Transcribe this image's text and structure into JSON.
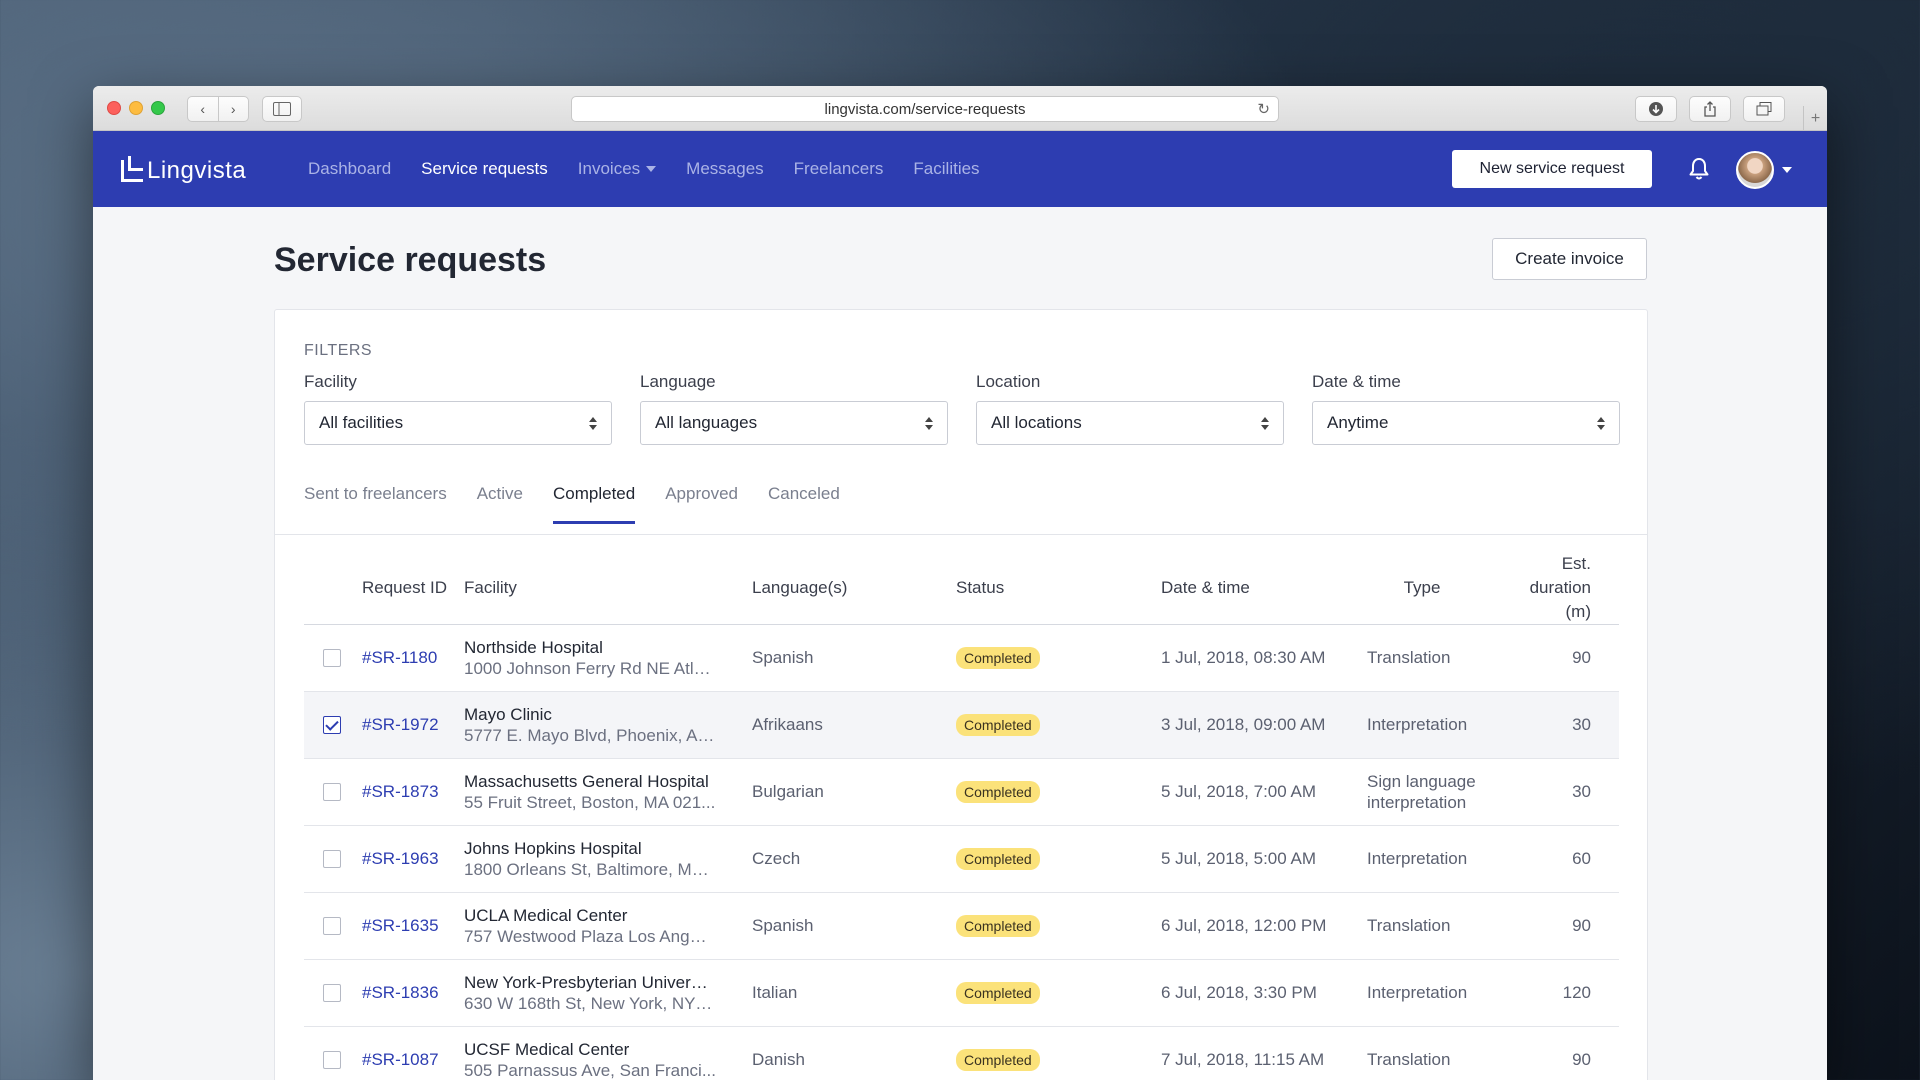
{
  "browser": {
    "url": "lingvista.com/service-requests",
    "back_icon": "chevron-left-icon",
    "forward_icon": "chevron-right-icon"
  },
  "nav": {
    "brand": "Lingvista",
    "links": [
      {
        "label": "Dashboard",
        "active": false
      },
      {
        "label": "Service requests",
        "active": true
      },
      {
        "label": "Invoices",
        "active": false,
        "dropdown": true
      },
      {
        "label": "Messages",
        "active": false
      },
      {
        "label": "Freelancers",
        "active": false
      },
      {
        "label": "Facilities",
        "active": false
      }
    ],
    "new_request_label": "New service request",
    "color": "#2d3db1"
  },
  "page": {
    "title": "Service requests",
    "create_invoice_label": "Create invoice"
  },
  "filters": {
    "heading": "FILTERS",
    "items": [
      {
        "label": "Facility",
        "value": "All facilities"
      },
      {
        "label": "Language",
        "value": "All languages"
      },
      {
        "label": "Location",
        "value": "All locations"
      },
      {
        "label": "Date & time",
        "value": "Anytime"
      }
    ]
  },
  "tabs": [
    {
      "label": "Sent to freelancers",
      "active": false
    },
    {
      "label": "Active",
      "active": false
    },
    {
      "label": "Completed",
      "active": true
    },
    {
      "label": "Approved",
      "active": false
    },
    {
      "label": "Canceled",
      "active": false
    }
  ],
  "table": {
    "headers": {
      "request_id": "Request ID",
      "facility": "Facility",
      "languages": "Language(s)",
      "status": "Status",
      "date_time": "Date & time",
      "type": "Type",
      "duration_line1": "Est.",
      "duration_line2": "duration (m)"
    },
    "rows": [
      {
        "checked": false,
        "id": "#SR-1180",
        "facility": "Northside Hospital",
        "address": "1000 Johnson Ferry Rd NE Atla...",
        "language": "Spanish",
        "status": "Completed",
        "datetime": "1 Jul, 2018, 08:30 AM",
        "type": "Translation",
        "duration": "90"
      },
      {
        "checked": true,
        "id": "#SR-1972",
        "facility": "Mayo Clinic",
        "address": "5777 E. Mayo Blvd, Phoenix, AZ...",
        "language": "Afrikaans",
        "status": "Completed",
        "datetime": "3 Jul, 2018, 09:00 AM",
        "type": "Interpretation",
        "duration": "30"
      },
      {
        "checked": false,
        "id": "#SR-1873",
        "facility": "Massachusetts General Hospital",
        "address": "55 Fruit Street, Boston, MA 021...",
        "language": "Bulgarian",
        "status": "Completed",
        "datetime": "5 Jul, 2018, 7:00 AM",
        "type_line1": "Sign language",
        "type_line2": "interpretation",
        "duration": "30"
      },
      {
        "checked": false,
        "id": "#SR-1963",
        "facility": "Johns Hopkins Hospital",
        "address": "1800 Orleans St, Baltimore, MD ...",
        "language": "Czech",
        "status": "Completed",
        "datetime": "5 Jul, 2018, 5:00 AM",
        "type": "Interpretation",
        "duration": "60"
      },
      {
        "checked": false,
        "id": "#SR-1635",
        "facility": "UCLA Medical Center",
        "address": "757 Westwood Plaza Los Angel...",
        "language": "Spanish",
        "status": "Completed",
        "datetime": "6 Jul, 2018, 12:00 PM",
        "type": "Translation",
        "duration": "90"
      },
      {
        "checked": false,
        "id": "#SR-1836",
        "facility": "New York-Presbyterian Universi...",
        "address": "630 W 168th St, New York, NY 1...",
        "language": "Italian",
        "status": "Completed",
        "datetime": "6 Jul, 2018, 3:30 PM",
        "type": "Interpretation",
        "duration": "120"
      },
      {
        "checked": false,
        "id": "#SR-1087",
        "facility": "UCSF Medical Center",
        "address": "505 Parnassus Ave, San Franci...",
        "language": "Danish",
        "status": "Completed",
        "datetime": "7 Jul, 2018, 11:15 AM",
        "type": "Translation",
        "duration": "90"
      }
    ]
  },
  "colors": {
    "badge": "#fbe27a",
    "link": "#2d3db1"
  }
}
